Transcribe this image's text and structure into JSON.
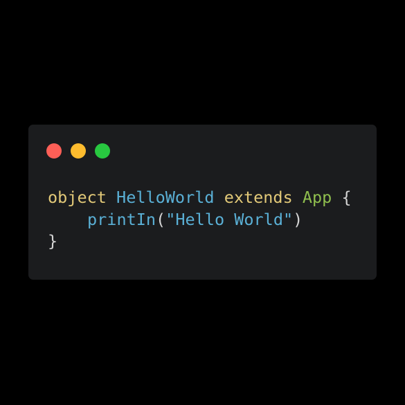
{
  "window": {
    "background": "#1b1c1e",
    "controls": [
      {
        "name": "close",
        "color": "#fe5f57"
      },
      {
        "name": "minimize",
        "color": "#febc2e"
      },
      {
        "name": "maximize",
        "color": "#28c840"
      }
    ]
  },
  "code": {
    "line1": {
      "kw_object": "object",
      "sp1": " ",
      "class_name": "HelloWorld",
      "sp2": " ",
      "kw_extends": "extends",
      "sp3": " ",
      "parent": "App",
      "sp4": " ",
      "brace_open": "{"
    },
    "line2": {
      "fn": "printIn",
      "paren_open": "(",
      "string": "\"Hello World\"",
      "paren_close": ")"
    },
    "line3": {
      "brace_close": "}"
    }
  },
  "colors": {
    "keyword": "#e2c978",
    "identifier": "#5ab0d6",
    "type": "#8fbe4e",
    "string": "#5ab0d6",
    "punctuation": "#d4d4d4"
  }
}
